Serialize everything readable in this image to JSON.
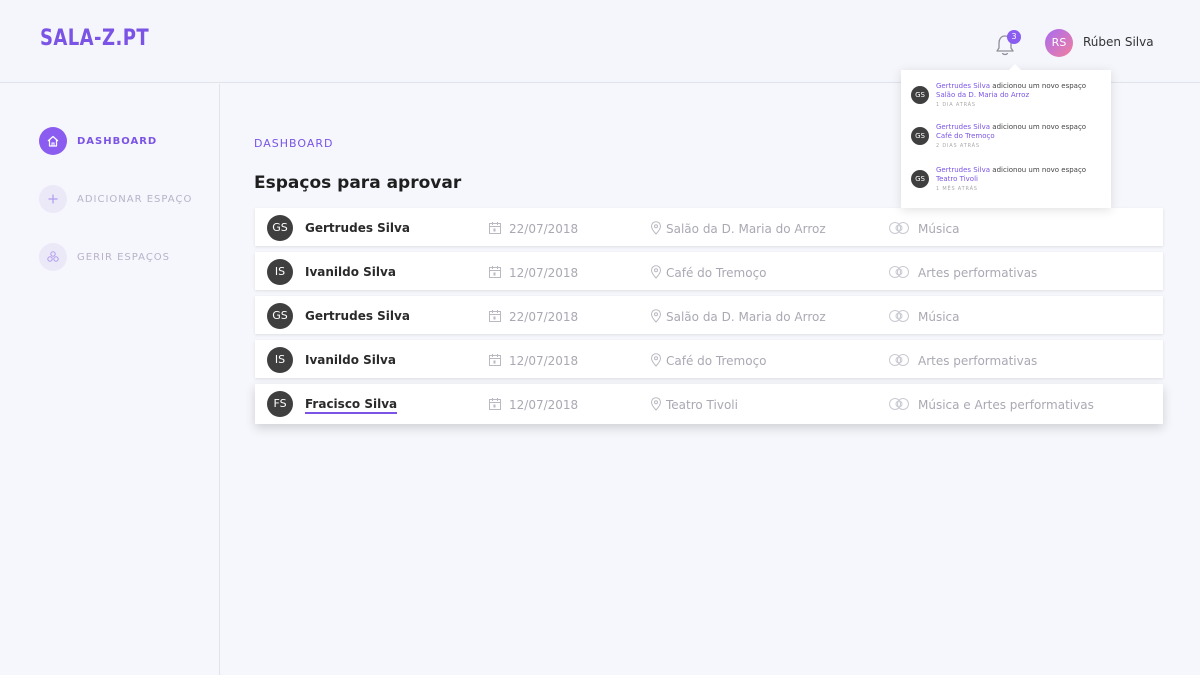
{
  "header": {
    "logo": "SALA-Z.PT",
    "notification_count": "3",
    "user_initials": "RS",
    "user_name": "Rúben Silva"
  },
  "sidebar": {
    "items": [
      {
        "label": "DASHBOARD",
        "icon": "home-icon",
        "active": true
      },
      {
        "label": "ADICIONAR ESPAÇO",
        "icon": "plus-icon",
        "active": false
      },
      {
        "label": "GERIR ESPAÇOS",
        "icon": "grid-icon",
        "active": false
      }
    ]
  },
  "main": {
    "section_label": "DASHBOARD",
    "title": "Espaços para aprovar",
    "rows": [
      {
        "initials": "GS",
        "name": "Gertrudes Silva",
        "date": "22/07/2018",
        "venue": "Salão da D. Maria do Arroz",
        "category": "Música"
      },
      {
        "initials": "IS",
        "name": "Ivanildo Silva",
        "date": "12/07/2018",
        "venue": "Café do Tremoço",
        "category": "Artes performativas"
      },
      {
        "initials": "GS",
        "name": "Gertrudes Silva",
        "date": "22/07/2018",
        "venue": "Salão da D. Maria do Arroz",
        "category": "Música"
      },
      {
        "initials": "IS",
        "name": "Ivanildo Silva",
        "date": "12/07/2018",
        "venue": "Café do Tremoço",
        "category": "Artes performativas"
      },
      {
        "initials": "FS",
        "name": "Fracisco Silva",
        "date": "12/07/2018",
        "venue": "Teatro Tivoli",
        "category": "Música e Artes performativas"
      }
    ]
  },
  "notifications": [
    {
      "initials": "GS",
      "who": "Gertrudes Silva",
      "action": " adicionou um novo espaço",
      "place": "Salão da D. Maria do Arroz",
      "time": "1 DIA ATRÁS"
    },
    {
      "initials": "GS",
      "who": "Gertrudes Silva",
      "action": " adicionou um novo espaço",
      "place": "Café do Tremoço",
      "time": "2 DIAS ATRÁS"
    },
    {
      "initials": "GS",
      "who": "Gertrudes Silva",
      "action": " adicionou um novo espaço",
      "place": "Teatro Tivoli",
      "time": "1 MÊS ATRÁS"
    }
  ],
  "colors": {
    "accent": "#7b54e6",
    "background": "#f5f7fc",
    "muted_text": "#a9a9b3"
  }
}
